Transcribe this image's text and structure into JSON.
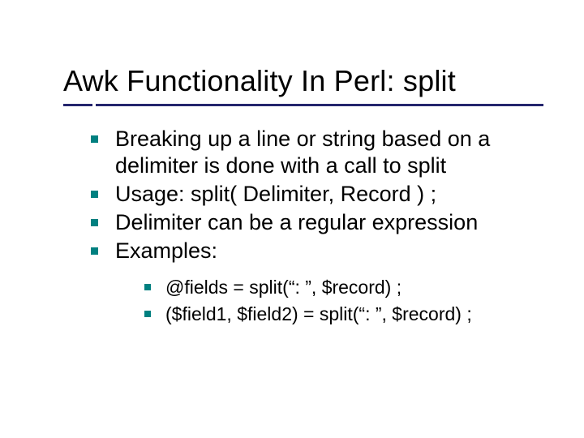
{
  "title": "Awk Functionality In Perl: split",
  "bullets": [
    "Breaking up a line or string based on a delimiter is done with a call to split",
    "Usage: split( Delimiter, Record ) ;",
    "Delimiter can be a regular expression",
    "Examples:"
  ],
  "examples": [
    "@fields = split(“: ”, $record) ;",
    "($field1, $field2) = split(“: ”, $record) ;"
  ]
}
